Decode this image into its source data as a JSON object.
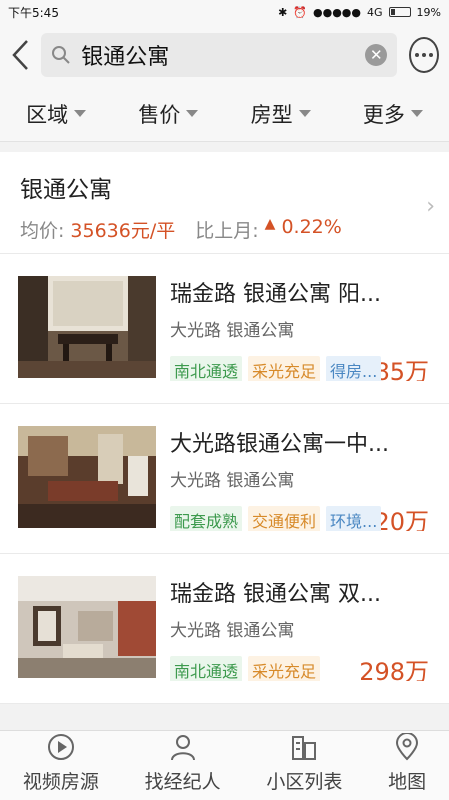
{
  "status": {
    "time": "下午5:45",
    "signal": "●●●●●",
    "network": "4G",
    "battery": "19%"
  },
  "search": {
    "query": "银通公寓"
  },
  "filters": [
    "区域",
    "售价",
    "房型",
    "更多"
  ],
  "community": {
    "name": "银通公寓",
    "avg_label": "均价:",
    "avg_value": "35636元/平",
    "mom_label": "比上月:",
    "mom_value": "0.22%",
    "mom_arrow": "▲"
  },
  "listings": [
    {
      "title": "瑞金路 银通公寓 阳...",
      "subtitle": "大光路 银通公寓",
      "price": "285万",
      "tags": [
        "南北通透",
        "采光充足",
        "得房..."
      ]
    },
    {
      "title": "大光路银通公寓一中...",
      "subtitle": "大光路 银通公寓",
      "price": "320万",
      "tags": [
        "配套成熟",
        "交通便利",
        "环境..."
      ]
    },
    {
      "title": "瑞金路 银通公寓 双...",
      "subtitle": "大光路 银通公寓",
      "price": "298万",
      "tags": [
        "南北通透",
        "采光充足"
      ]
    }
  ],
  "tabbar": [
    "视频房源",
    "找经纪人",
    "小区列表",
    "地图"
  ],
  "colors": {
    "accent": "#d45226",
    "tag_green": "#3d9a4e",
    "tag_orange": "#d78a2a",
    "tag_blue": "#4a87c2"
  }
}
